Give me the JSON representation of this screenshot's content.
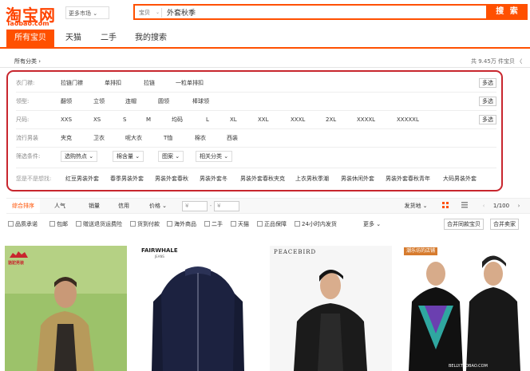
{
  "header": {
    "logo_text": "淘宝网",
    "logo_sub": "Taobao.com",
    "market": "更多市场 ⌄",
    "search_scope": "宝贝",
    "search_query": "外套秋季",
    "search_button": "搜 索"
  },
  "tabs": [
    "所有宝贝",
    "天猫",
    "二手",
    "我的搜索"
  ],
  "breadcrumb": "所有分类 ›",
  "total": "共 9.45万 件宝贝 〈",
  "filters": {
    "row1": {
      "label": "衣门襟:",
      "values": [
        "拉链门襟",
        "单排扣",
        "拉链",
        "一粒单排扣"
      ],
      "more": "多选"
    },
    "row2": {
      "label": "领型:",
      "values": [
        "翻领",
        "立领",
        "连帽",
        "圆领",
        "棒球领"
      ],
      "more": "多选"
    },
    "row3": {
      "label": "尺码:",
      "values": [
        "XXS",
        "XS",
        "S",
        "M",
        "均码",
        "L",
        "XL",
        "XXL",
        "XXXL",
        "2XL",
        "XXXXL",
        "XXXXXL"
      ],
      "more": "多选"
    },
    "row4": {
      "label": "流行男装",
      "values": [
        "夹克",
        "卫衣",
        "呢大衣",
        "T恤",
        "棉衣",
        "西装"
      ]
    },
    "row5": {
      "label": "筛选条件:",
      "values": [
        "选购热点 ⌄",
        "棉含量 ⌄",
        "图案 ⌄",
        "相关分类 ⌄"
      ]
    },
    "row6": {
      "label": "您是不是想找:",
      "values": [
        "红豆男装外套",
        "春季男装外套",
        "男装外套春秋",
        "男装外套冬",
        "男装外套春秋夹克",
        "上衣男秋季潮",
        "男装休闲外套",
        "男装外套春秋青年",
        "大码男装外套"
      ]
    }
  },
  "sort": {
    "items": [
      "综合排序",
      "人气",
      "销量",
      "信用",
      "价格 ⌄"
    ],
    "price_min": "¥",
    "price_max": "¥",
    "dash": "-",
    "ship": "发货地 ⌄",
    "page": "1/100"
  },
  "options": [
    "品质承诺",
    "包邮",
    "赠送退货运费险",
    "货到付款",
    "海外商品",
    "二手",
    "天猫",
    "正品保障",
    "24小时内发货"
  ],
  "option_more": "更多 ⌄",
  "merge_buy": "合并同款宝贝",
  "merge_seller": "合并卖家",
  "products": [
    {
      "brand": "骆驼男装",
      "brand_color": "#c8262e"
    },
    {
      "brand": "FAIRWHALE",
      "brand_sub": "JEANS"
    },
    {
      "brand": "PEACEBIRD"
    },
    {
      "brand": "潮乐坊的店铺",
      "watermark": "BELLY.TAOBAO.COM"
    }
  ],
  "colors": {
    "accent": "#ff5000",
    "highlight": "#c8262e"
  }
}
